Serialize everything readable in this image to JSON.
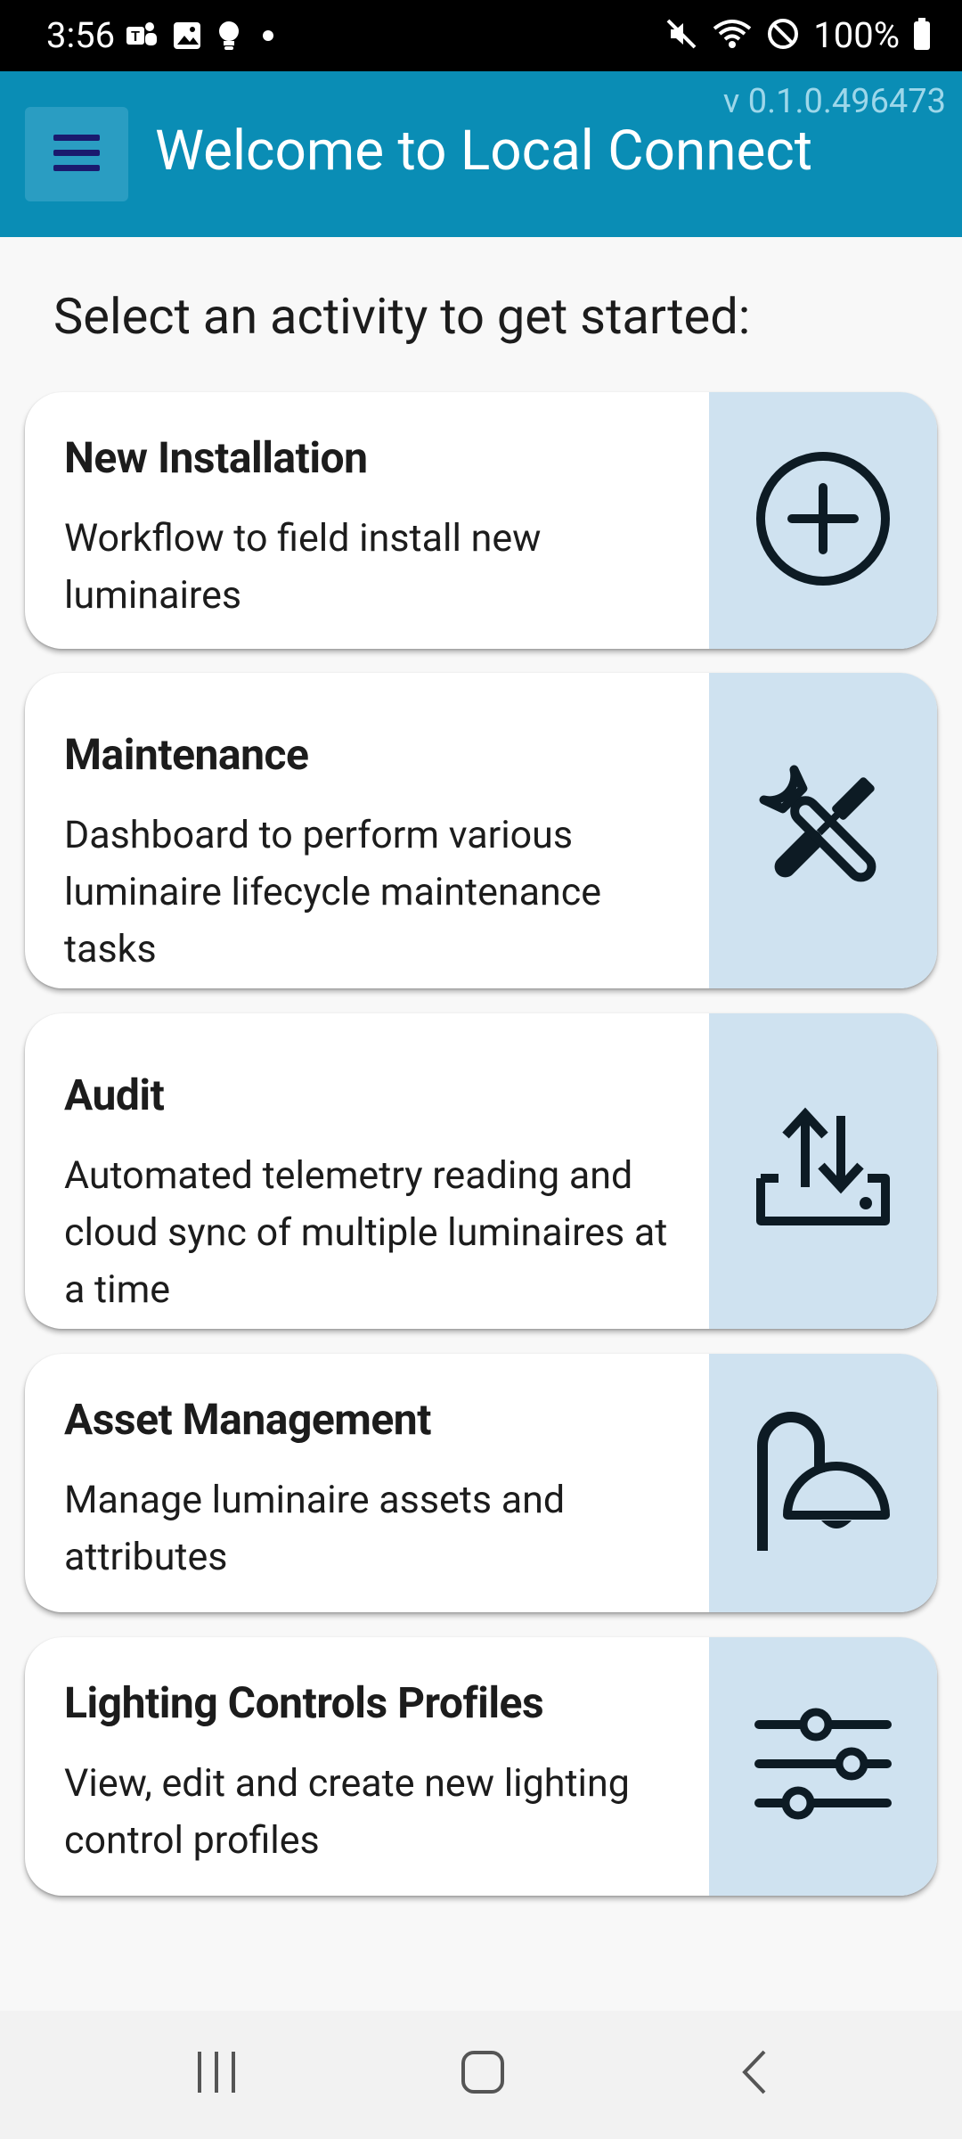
{
  "status_bar": {
    "time": "3:56",
    "battery_text": "100%",
    "left_icons": [
      "teams-icon",
      "gallery-icon",
      "bulb-icon",
      "dot-icon"
    ],
    "right_icons": [
      "mute-icon",
      "wifi-icon",
      "do-not-disturb-icon",
      "battery-icon"
    ]
  },
  "app_bar": {
    "title": "Welcome to Local Connect",
    "version": "v 0.1.0.496473",
    "menu_icon": "hamburger-icon",
    "color": "#0a8db5"
  },
  "main": {
    "prompt": "Select an activity to get started:",
    "cards": [
      {
        "title": "New Installation",
        "description": "Workflow to field install new luminaires",
        "icon": "add-circle-icon"
      },
      {
        "title": "Maintenance",
        "description": "Dashboard to perform various luminaire lifecycle maintenance tasks",
        "icon": "tools-icon"
      },
      {
        "title": "Audit",
        "description": "Automated telemetry reading and cloud sync of multiple luminaires at a time",
        "icon": "upload-download-icon"
      },
      {
        "title": "Asset Management",
        "description": "Manage luminaire assets and attributes",
        "icon": "street-lamp-icon"
      },
      {
        "title": "Lighting Controls Profiles",
        "description": "View, edit and create new lighting control profiles",
        "icon": "sliders-icon"
      }
    ]
  },
  "nav_bar": {
    "icons": [
      "recent-apps-icon",
      "home-icon",
      "back-icon"
    ]
  }
}
